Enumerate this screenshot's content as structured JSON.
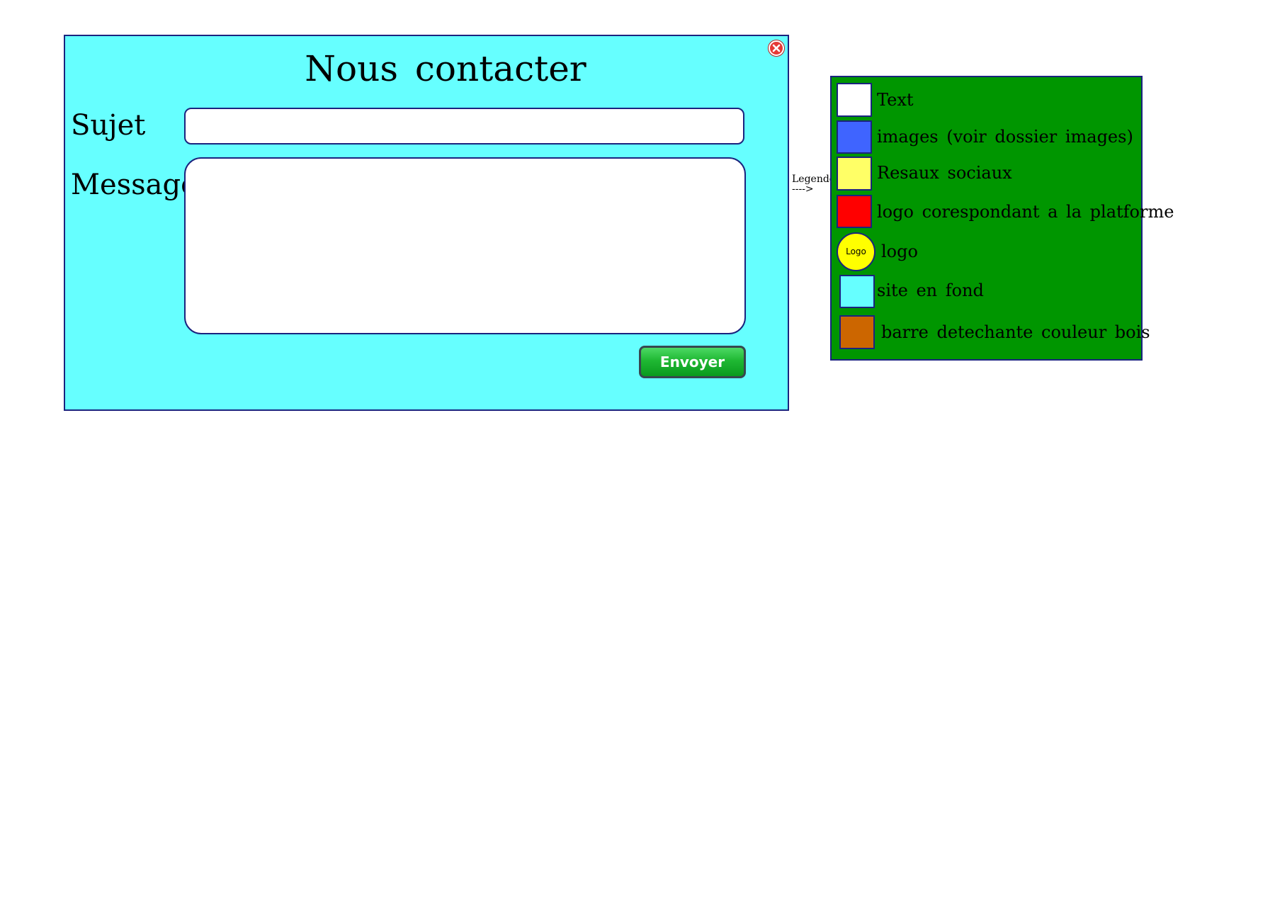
{
  "form": {
    "title": "Nous contacter",
    "subject_label": "Sujet",
    "subject_value": "",
    "message_label": "Message",
    "message_value": "",
    "send_label": "Envoyer",
    "background_color": "#66ffff",
    "close_icon": "close-icon"
  },
  "legend_pointer": {
    "label": "Legende",
    "arrow": "---->"
  },
  "legend": {
    "background_color": "#009600",
    "items": [
      {
        "label": "Text",
        "color": "#ffffff",
        "shape": "square"
      },
      {
        "label": "images (voir dossier images)",
        "color": "#3f64ff",
        "shape": "square"
      },
      {
        "label": "Resaux sociaux",
        "color": "#ffff66",
        "shape": "square"
      },
      {
        "label": "logo corespondant a la platforme",
        "color": "#ff0000",
        "shape": "square"
      },
      {
        "label": "logo",
        "color": "#ffff00",
        "shape": "circle",
        "badge": "Logo"
      },
      {
        "label": "site en fond",
        "color": "#66ffff",
        "shape": "square"
      },
      {
        "label": "barre detechante couleur bois",
        "color": "#cc6600",
        "shape": "square"
      }
    ]
  }
}
